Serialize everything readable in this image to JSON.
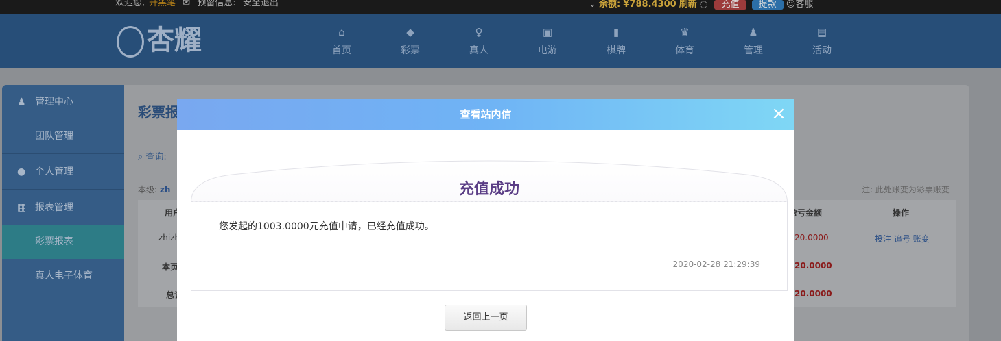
{
  "topbar": {
    "welcome": "欢迎您,",
    "username": "开黑笔",
    "reserve_info": "预留信息:",
    "logout": "安全退出",
    "balance_label": "余额:",
    "balance_value": "¥788.4300",
    "refresh": "刷新",
    "recharge": "充值",
    "withdraw": "提款",
    "service": "客服"
  },
  "brand": {
    "name": "杏耀"
  },
  "nav": {
    "items": [
      {
        "label": "首页",
        "icon": "home-icon"
      },
      {
        "label": "彩票",
        "icon": "lottery-icon"
      },
      {
        "label": "真人",
        "icon": "live-icon"
      },
      {
        "label": "电游",
        "icon": "game-icon"
      },
      {
        "label": "棋牌",
        "icon": "cards-icon"
      },
      {
        "label": "体育",
        "icon": "trophy-icon"
      },
      {
        "label": "管理",
        "icon": "users-icon"
      },
      {
        "label": "活动",
        "icon": "gift-icon"
      }
    ]
  },
  "sidebar": {
    "items": [
      {
        "label": "管理中心"
      },
      {
        "label": "团队管理"
      },
      {
        "label": "个人管理"
      },
      {
        "label": "报表管理"
      },
      {
        "label": "彩票报表"
      },
      {
        "label": "真人电子体育"
      }
    ]
  },
  "content": {
    "title": "彩票报",
    "query": "查询:",
    "level": "本级:",
    "level_user": "zh",
    "note": "注: 此处账变为彩票账变",
    "col_user": "用户",
    "col_profit": "盈亏金额",
    "col_action": "操作",
    "rows": [
      {
        "user": "zhizh",
        "profit": "20.0000",
        "action": "投注 追号 账变"
      },
      {
        "user": "本页",
        "profit": "20.0000",
        "action": "--"
      },
      {
        "user": "总计",
        "profit": "20.0000",
        "action": "--"
      }
    ]
  },
  "modal": {
    "title": "查看站内信",
    "heading": "充值成功",
    "message": "您发起的1003.0000元充值申请，已经充值成功。",
    "time": "2020-02-28 21:29:39",
    "back_button": "返回上一页"
  }
}
